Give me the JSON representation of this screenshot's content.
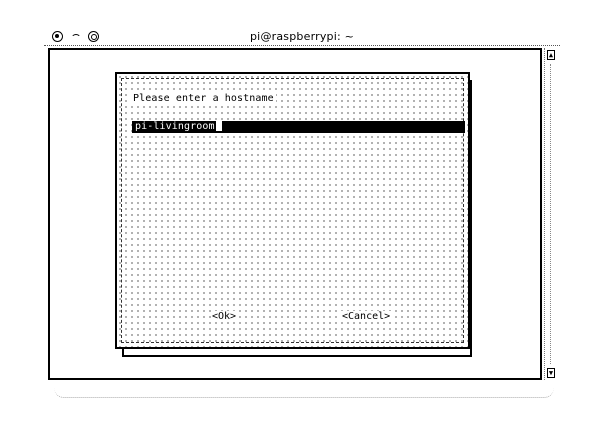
{
  "window": {
    "title": "pi@raspberrypi: ~",
    "buttons": [
      {
        "name": "close"
      },
      {
        "name": "minimize"
      },
      {
        "name": "maximize"
      }
    ]
  },
  "dialog": {
    "prompt": "Please enter a hostname",
    "hostname_value": "pi-livingroom",
    "ok_label": "<Ok>",
    "cancel_label": "<Cancel>"
  },
  "icons": {
    "scroll_up": "up-arrow-icon",
    "scroll_down": "down-arrow-icon"
  }
}
